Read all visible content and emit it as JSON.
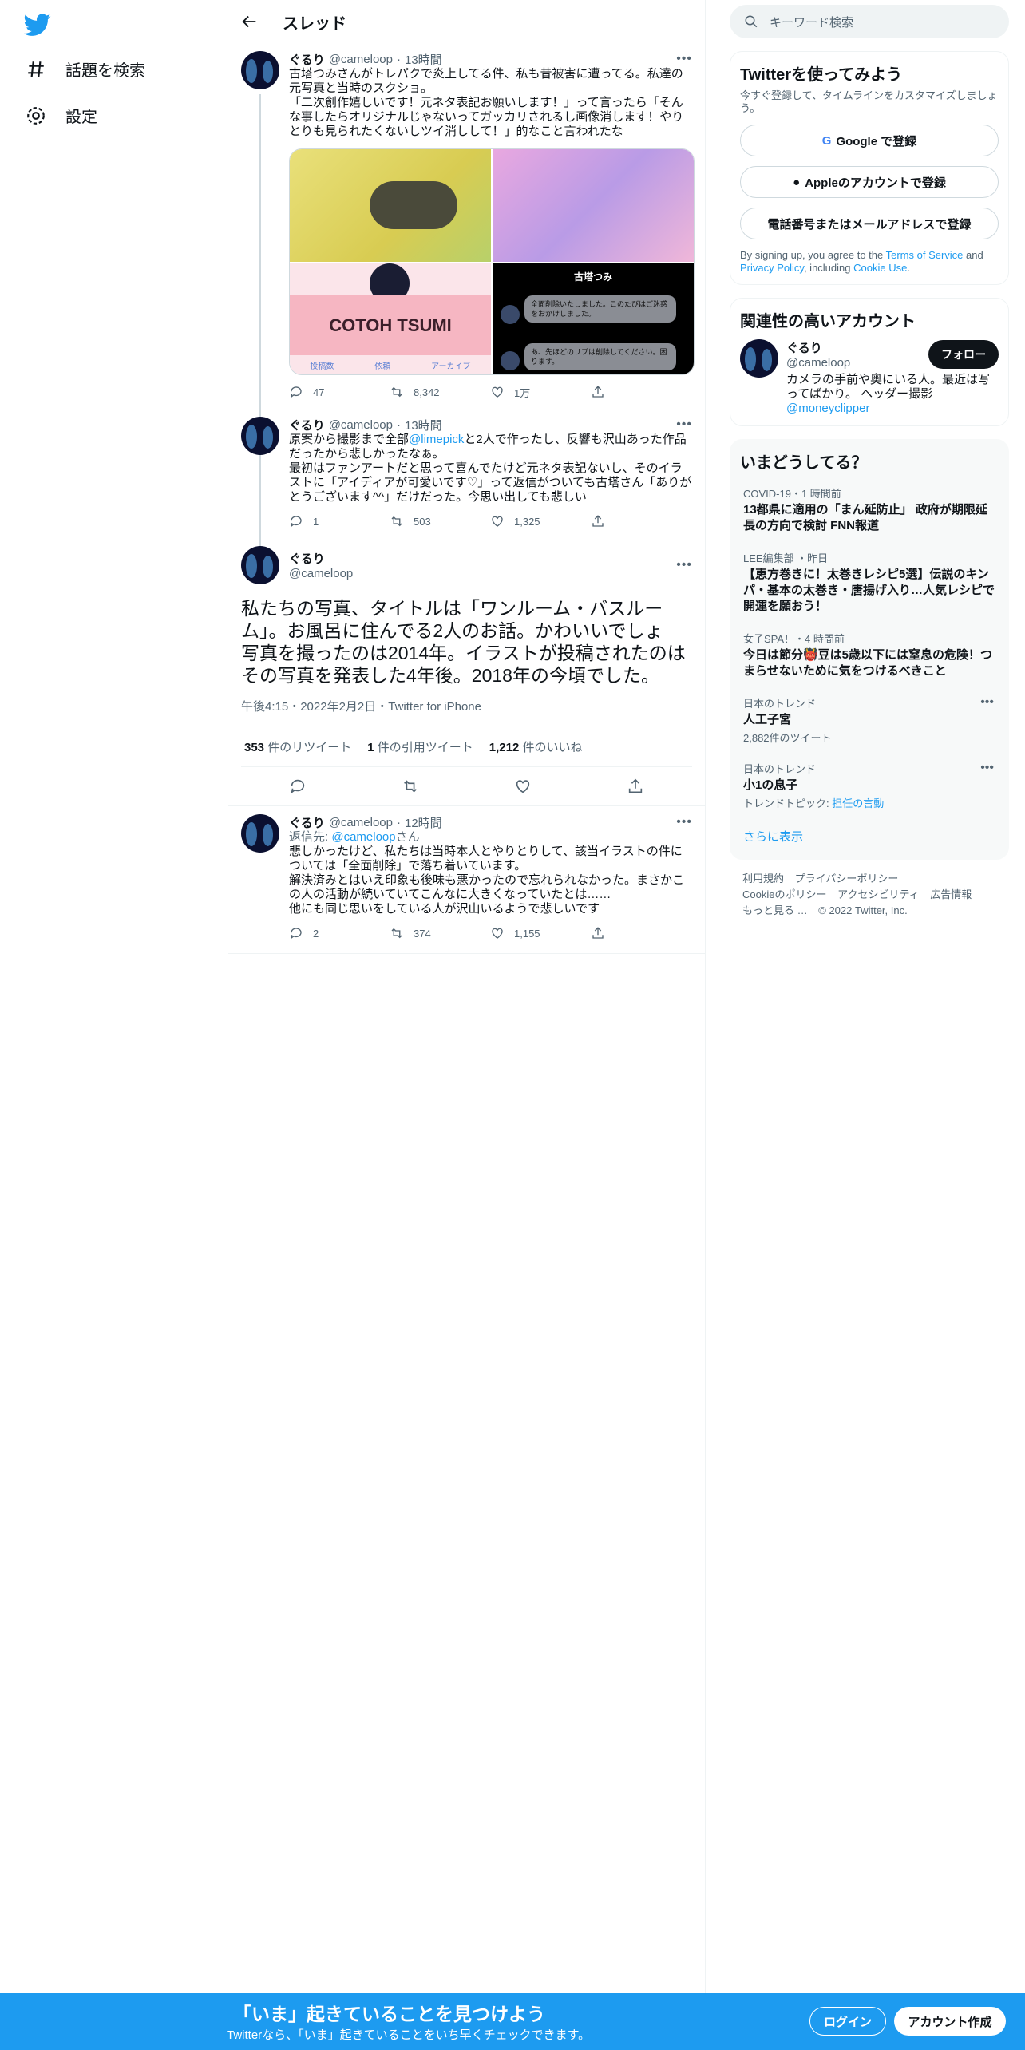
{
  "nav": {
    "explore_label": "話題を検索",
    "settings_label": "設定"
  },
  "header": {
    "title": "スレッド"
  },
  "tweets": [
    {
      "name": "ぐるり",
      "handle": "@cameloop",
      "time": "13時間",
      "text": "古塔つみさんがトレパクで炎上してる件、私も昔被害に遭ってる。私達の元写真と当時のスクショ。\n「二次創作嬉しいです！元ネタ表記お願いします！」って言ったら「そんな事したらオリジナルじゃないってガッカリされるし画像消します！やりとりも見られたくないしツイ消しして！」的なこと言われたな",
      "replies": "47",
      "retweets": "8,342",
      "likes": "1万"
    },
    {
      "name": "ぐるり",
      "handle": "@cameloop",
      "time": "13時間",
      "text_a": "原案から撮影まで全部",
      "mention": "@limepick",
      "text_b": "と2人で作ったし、反響も沢山あった作品だったから悲しかったなぁ。\n最初はファンアートだと思って喜んでたけど元ネタ表記ないし、そのイラストに「アイディアが可愛いです♡」って返信がついても古塔さん「ありがとうございます^^」だけだった。今思い出しても悲しい",
      "replies": "1",
      "retweets": "503",
      "likes": "1,325"
    }
  ],
  "main_tweet": {
    "name": "ぐるり",
    "handle": "@cameloop",
    "text": "私たちの写真、タイトルは「ワンルーム・バスルーム」。お風呂に住んでる2人のお話。かわいいでしょ\n写真を撮ったのは2014年。イラストが投稿されたのはその写真を発表した4年後。2018年の今頃でした。",
    "meta": "午後4:15・2022年2月2日・Twitter for iPhone",
    "retweets_count": "353",
    "retweets_label": "件のリツイート",
    "quotes_count": "1",
    "quotes_label": "件の引用ツイート",
    "likes_count": "1,212",
    "likes_label": "件のいいね"
  },
  "reply_tweet": {
    "name": "ぐるり",
    "handle": "@cameloop",
    "time": "12時間",
    "reply_to_prefix": "返信先: ",
    "reply_to_handle": "@cameloop",
    "reply_to_suffix": "さん",
    "text": "悲しかったけど、私たちは当時本人とやりとりして、該当イラストの件については「全面削除」で落ち着いています。\n解決済みとはいえ印象も後味も悪かったので忘れられなかった。まさかこの人の活動が続いていてこんなに大きくなっていたとは……\n他にも同じ思いをしている人が沢山いるようで悲しいです",
    "replies": "2",
    "retweets": "374",
    "likes": "1,155"
  },
  "media": {
    "m3_title": "COTOH TSUMI",
    "m3_link1": "投稿数",
    "m3_link2": "依頼",
    "m3_link3": "アーカイブ",
    "m4_title": "古塔つみ",
    "m4_msg1": "全面削除いたしました。このたびはご迷惑をおかけしました。",
    "m4_msg2": "あ、先ほどのリプは削除してください。困ります。"
  },
  "search": {
    "placeholder": "キーワード検索"
  },
  "signup": {
    "title": "Twitterを使ってみよう",
    "subtitle": "今すぐ登録して、タイムラインをカスタマイズしましょう。",
    "google": "Google で登録",
    "apple": "Appleのアカウントで登録",
    "phone": "電話番号またはメールアドレスで登録",
    "terms_a": "By signing up, you agree to the ",
    "terms_link1": "Terms of Service",
    "terms_b": " and ",
    "terms_link2": "Privacy Policy",
    "terms_c": ", including ",
    "terms_link3": "Cookie Use",
    "terms_d": "."
  },
  "related": {
    "title": "関連性の高いアカウント",
    "name": "ぐるり",
    "handle": "@cameloop",
    "follow": "フォロー",
    "bio": "カメラの手前や奥にいる人。最近は写ってばかり。 ヘッダー撮影",
    "bio_mention": "@moneyclipper"
  },
  "trends": {
    "title": "いまどうしてる？",
    "items": [
      {
        "cat": "COVID-19・1 時間前",
        "title": "13都県に適用の「まん延防止」 政府が期限延長の方向で検討 FNN報道"
      },
      {
        "cat": "LEE編集部 ・昨日",
        "title": "【恵方巻きに！太巻きレシピ5選】伝説のキンパ・基本の太巻き・唐揚げ入り…人気レシピで開運を願おう！"
      },
      {
        "cat": "女子SPA！・4 時間前",
        "title": "今日は節分👹豆は5歳以下には窒息の危険！つまらせないために気をつけるべきこと"
      },
      {
        "cat": "日本のトレンド",
        "title": "人工子宮",
        "count": "2,882件のツイート"
      },
      {
        "cat": "日本のトレンド",
        "title": "小1の息子",
        "count_a": "トレンドトピック: ",
        "count_link": "担任の言動"
      }
    ],
    "more": "さらに表示"
  },
  "footer": {
    "links": [
      "利用規約",
      "プライバシーポリシー",
      "Cookieのポリシー",
      "アクセシビリティ",
      "広告情報",
      "もっと見る …",
      "© 2022 Twitter, Inc."
    ]
  },
  "bottom": {
    "headline": "「いま」起きていることを見つけよう",
    "sub": "Twitterなら、「いま」起きていることをいち早くチェックできます。",
    "login": "ログイン",
    "signup": "アカウント作成"
  },
  "colors": {
    "accent": "#1d9bf0",
    "text": "#0f1419",
    "muted": "#536471"
  }
}
